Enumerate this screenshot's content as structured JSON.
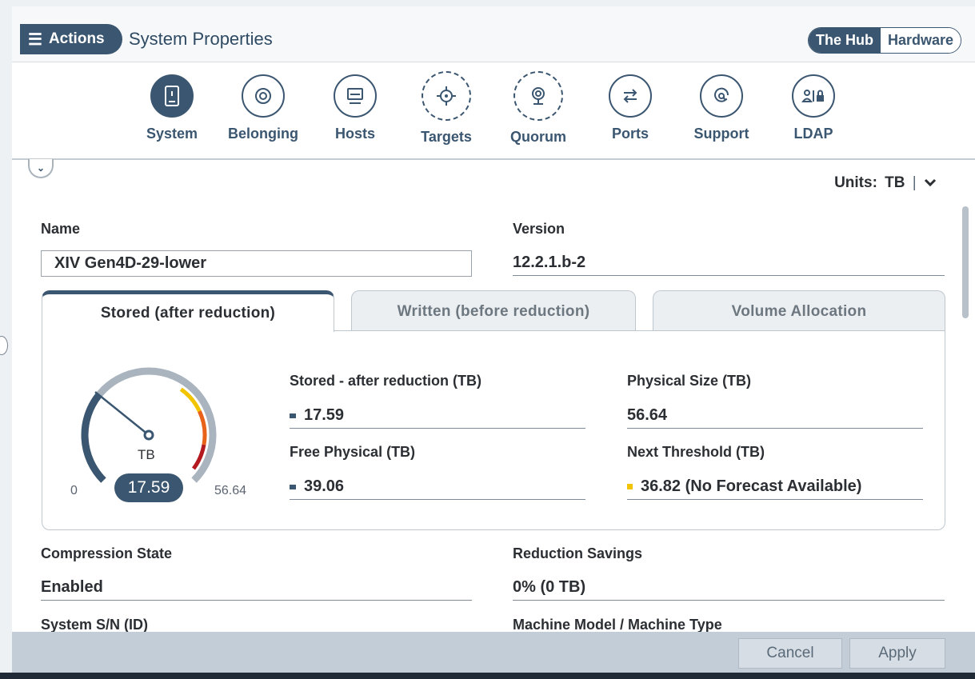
{
  "header": {
    "actions_label": "Actions",
    "title": "System Properties",
    "toggle": {
      "left": "The Hub",
      "right": "Hardware",
      "active": "left"
    }
  },
  "nav": [
    {
      "label": "System",
      "icon": "server-icon",
      "active": true
    },
    {
      "label": "Belonging",
      "icon": "target-ring-icon"
    },
    {
      "label": "Hosts",
      "icon": "monitor-icon"
    },
    {
      "label": "Targets",
      "icon": "crosshair-icon"
    },
    {
      "label": "Quorum",
      "icon": "webcam-icon"
    },
    {
      "label": "Ports",
      "icon": "swap-arrows-icon"
    },
    {
      "label": "Support",
      "icon": "support-at-icon"
    },
    {
      "label": "LDAP",
      "icon": "user-lock-icon"
    }
  ],
  "units": {
    "label": "Units:",
    "value": "TB"
  },
  "fields": {
    "name_label": "Name",
    "name_value": "XIV Gen4D-29-lower",
    "version_label": "Version",
    "version_value": "12.2.1.b-2",
    "compression_label": "Compression State",
    "compression_value": "Enabled",
    "reduction_label": "Reduction Savings",
    "reduction_value": "0% (0 TB)",
    "sn_label": "System S/N (ID)",
    "model_label": "Machine Model / Machine Type"
  },
  "tabs": [
    {
      "label": "Stored (after reduction)",
      "active": true
    },
    {
      "label": "Written (before reduction)"
    },
    {
      "label": "Volume Allocation"
    }
  ],
  "gauge": {
    "unit": "TB",
    "value_text": "17.59",
    "min_text": "0",
    "max_text": "56.64",
    "value": 17.59,
    "max": 56.64
  },
  "metrics": {
    "stored_label": "Stored - after reduction (TB)",
    "stored_value": "17.59",
    "free_label": "Free Physical (TB)",
    "free_value": "39.06",
    "physical_label": "Physical Size (TB)",
    "physical_value": "56.64",
    "threshold_label": "Next Threshold (TB)",
    "threshold_value": "36.82 (No Forecast Available)"
  },
  "colors": {
    "primary": "#3b5670",
    "threshold_marker": "#f2c400"
  },
  "footer": {
    "cancel": "Cancel",
    "apply": "Apply"
  }
}
